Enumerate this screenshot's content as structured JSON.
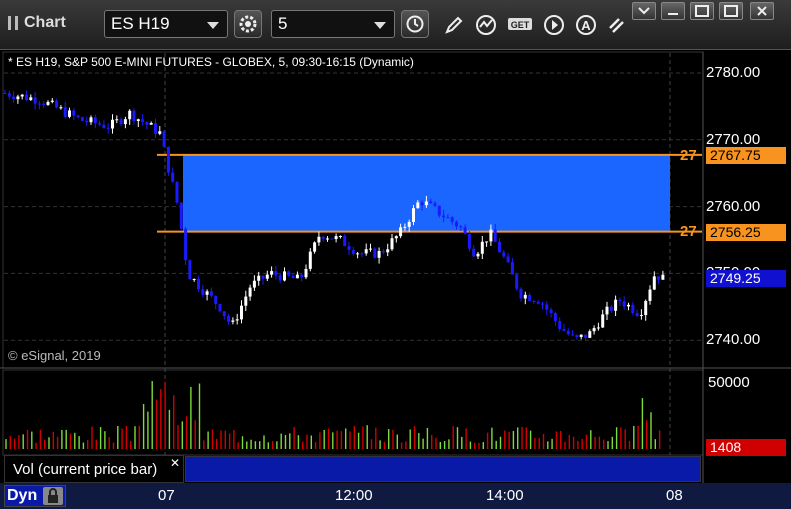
{
  "toolbar": {
    "title": "Chart",
    "symbol": "ES H19",
    "interval": "5"
  },
  "chart": {
    "info": "* ES H19, S&P 500 E-MINI FUTURES - GLOBEX, 5, 09:30-16:15 (Dynamic)",
    "copyright": "© eSignal, 2019",
    "price_axis": [
      "2780.00",
      "2770.00",
      "2760.00",
      "2750.00",
      "2740.00"
    ],
    "upper_level": {
      "label": "2767.75",
      "short": "27",
      "value": 2767.75
    },
    "lower_level": {
      "label": "2756.25",
      "short": "27",
      "value": 2756.25
    },
    "last_price": "2749.25",
    "time_axis": [
      "07",
      "12:00",
      "14:00",
      "08"
    ],
    "colors": {
      "up": "#ffffff",
      "down": "#1a1aff",
      "zone": "#1a66ff",
      "level": "#f7931e",
      "last": "#1010d0"
    }
  },
  "volume": {
    "axis_label": "50000",
    "current": "1408",
    "legend": "Vol (current price bar)"
  },
  "bottom": {
    "mode": "Dyn"
  }
}
